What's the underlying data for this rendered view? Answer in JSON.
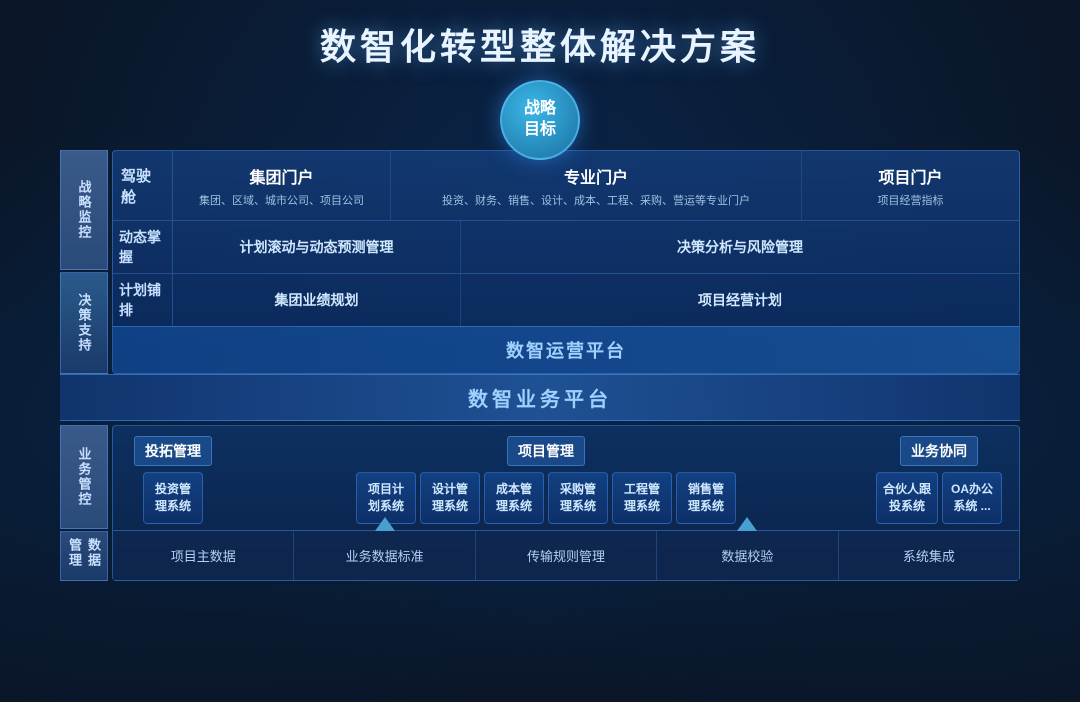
{
  "title": "数智化转型整体解决方案",
  "strategy_circle": {
    "line1": "战略",
    "line2": "目标"
  },
  "left_labels": {
    "strategic_monitor": "战略监控",
    "decision_support": "决策支持",
    "business_control": "业务管控",
    "data_management": "数据管理"
  },
  "cockpit": {
    "label": "驾驶舱",
    "group_portal": {
      "title": "集团门户",
      "sub": "集团、区域、城市公司、项目公司"
    },
    "professional_portal": {
      "title": "专业门户",
      "sub": "投资、财务、销售、设计、成本、工程、采购、营运等专业门户"
    },
    "project_portal": {
      "title": "项目门户",
      "sub": "项目经营指标"
    }
  },
  "dynamic": {
    "label": "动态掌握",
    "cell1": "计划滚动与动态预测管理",
    "cell2": "决策分析与风险管理"
  },
  "plan": {
    "label": "计划铺排",
    "cell1": "集团业绩规划",
    "cell2": "项目经营计划"
  },
  "ops_platform": "数智运营平台",
  "biz_platform": "数智业务平台",
  "investment": {
    "title": "投拓管理",
    "items": [
      {
        "name": "投资管\n理系统"
      }
    ]
  },
  "project_mgmt": {
    "title": "项目管理",
    "items": [
      {
        "name": "项目计\n划系统"
      },
      {
        "name": "设计管\n理系统"
      },
      {
        "name": "成本管\n理系统"
      },
      {
        "name": "采购管\n理系统"
      },
      {
        "name": "工程管\n理系统"
      },
      {
        "name": "销售管\n理系统"
      }
    ]
  },
  "collaboration": {
    "title": "业务协同",
    "items": [
      {
        "name": "合伙人跟\n投系统"
      },
      {
        "name": "OA办公\n系统 ..."
      }
    ]
  },
  "data_row": {
    "items": [
      {
        "label": "项目主数据",
        "has_arrow": false
      },
      {
        "label": "业务数据标准",
        "has_arrow": true
      },
      {
        "label": "传输规则管理",
        "has_arrow": false
      },
      {
        "label": "数据校验",
        "has_arrow": true
      },
      {
        "label": "系统集成",
        "has_arrow": false
      }
    ]
  }
}
